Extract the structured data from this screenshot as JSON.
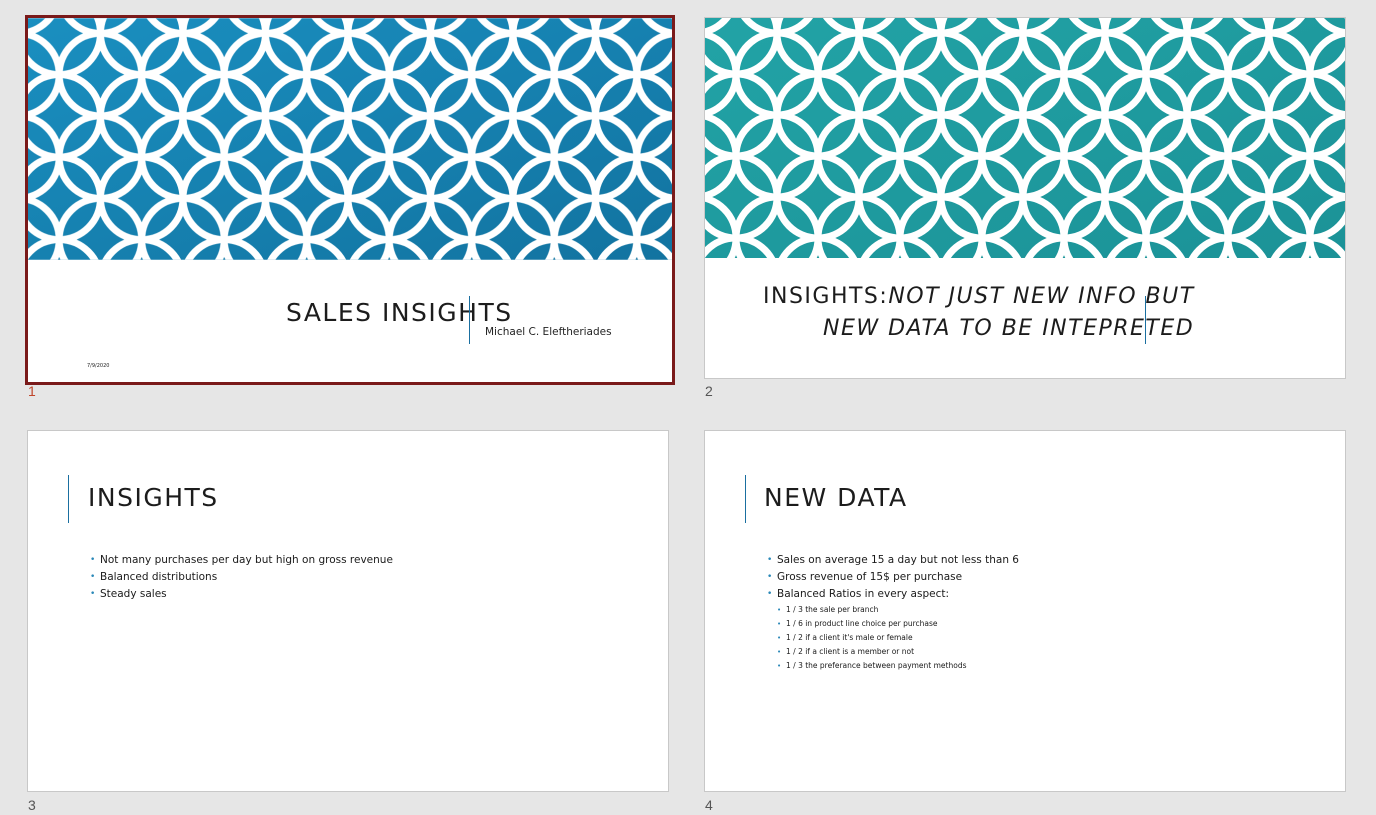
{
  "colors": {
    "pattern_blue": "#1480ad",
    "pattern_teal": "#1f9a9e",
    "accent_bar": "#1a6fa0",
    "selected_border": "#7a1a1a",
    "selected_number": "#c0452a",
    "bullet": "#2a88b8"
  },
  "slides": [
    {
      "number": "1",
      "title": "SALES INSIGHTS",
      "subtitle": "Michael C. Eleftheriades",
      "date": "7/9/2020"
    },
    {
      "number": "2",
      "title_prefix": "INSIGHTS:",
      "title_line1_italic": "NOT JUST NEW INFO BUT",
      "title_line2_italic": "NEW DATA TO BE INTEPRETED"
    },
    {
      "number": "3",
      "title": "INSIGHTS",
      "bullets": [
        "Not many purchases per day but high on gross revenue",
        "Balanced distributions",
        "Steady sales"
      ]
    },
    {
      "number": "4",
      "title": "NEW DATA",
      "bullets": [
        "Sales on average 15 a day but not less than 6",
        "Gross revenue of 15$ per purchase",
        "Balanced Ratios in every aspect:"
      ],
      "sub_bullets": [
        "1 / 3 the sale per branch",
        "1 / 6 in product line choice per purchase",
        "1 / 2 if a client it's male or female",
        "1 / 2 if a client is a member or not",
        "1 / 3 the preferance between payment methods"
      ]
    }
  ]
}
